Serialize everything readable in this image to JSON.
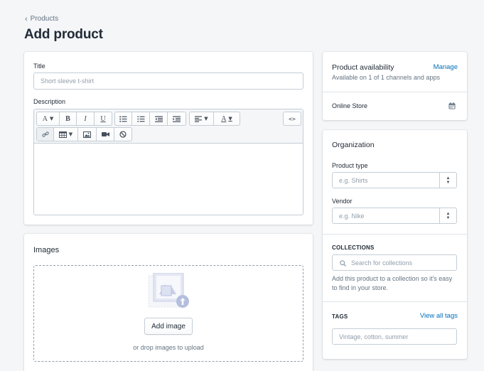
{
  "breadcrumb": {
    "label": "Products"
  },
  "page": {
    "title": "Add product"
  },
  "main_card": {
    "title_label": "Title",
    "title_placeholder": "Short sleeve t-shirt",
    "description_label": "Description",
    "toolbar": {
      "font_label": "A",
      "bold_label": "B",
      "italic_label": "I",
      "underline_label": "U",
      "color_label": "A",
      "html_label": "<>"
    }
  },
  "images_card": {
    "title": "Images",
    "add_image_label": "Add image",
    "drop_hint": "or drop images to upload"
  },
  "availability_card": {
    "title": "Product availability",
    "manage_label": "Manage",
    "subtitle": "Available on 1 of 1 channels and apps",
    "channel_label": "Online Store"
  },
  "organization_card": {
    "title": "Organization",
    "product_type_label": "Product type",
    "product_type_placeholder": "e.g. Shirts",
    "vendor_label": "Vendor",
    "vendor_placeholder": "e.g. Nike",
    "collections_heading": "COLLECTIONS",
    "collections_placeholder": "Search for collections",
    "collections_help": "Add this product to a collection so it's easy to find in your store.",
    "tags_heading": "TAGS",
    "view_all_tags_label": "View all tags",
    "tags_placeholder": "Vintage, cotton, summer"
  },
  "colors": {
    "background": "#f4f6f8",
    "link": "#006fbb",
    "border": "#c4cdd5",
    "text": "#212b36",
    "muted": "#637381"
  }
}
